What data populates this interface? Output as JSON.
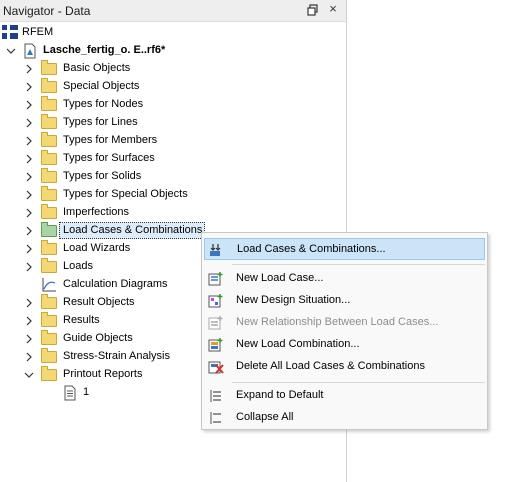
{
  "panel": {
    "title": "Navigator - Data",
    "pin_icon": "pin-icon",
    "close_icon": "close-icon",
    "close_glyph": "×"
  },
  "tree": {
    "root_label": "RFEM",
    "model_label": "Lasche_fertig_o. E..rf6*",
    "items": [
      {
        "label": "Basic Objects",
        "icon": "folder-icon"
      },
      {
        "label": "Special Objects",
        "icon": "folder-icon"
      },
      {
        "label": "Types for Nodes",
        "icon": "folder-icon"
      },
      {
        "label": "Types for Lines",
        "icon": "folder-icon"
      },
      {
        "label": "Types for Members",
        "icon": "folder-icon"
      },
      {
        "label": "Types for Surfaces",
        "icon": "folder-icon"
      },
      {
        "label": "Types for Solids",
        "icon": "folder-icon"
      },
      {
        "label": "Types for Special Objects",
        "icon": "folder-icon"
      },
      {
        "label": "Imperfections",
        "icon": "folder-icon"
      },
      {
        "label": "Load Cases & Combinations",
        "icon": "folder-icon",
        "selected": true
      },
      {
        "label": "Load Wizards",
        "icon": "folder-icon"
      },
      {
        "label": "Loads",
        "icon": "folder-icon"
      },
      {
        "label": "Calculation Diagrams",
        "icon": "diagram-icon"
      },
      {
        "label": "Result Objects",
        "icon": "folder-icon"
      },
      {
        "label": "Results",
        "icon": "folder-icon"
      },
      {
        "label": "Guide Objects",
        "icon": "folder-icon"
      },
      {
        "label": "Stress-Strain Analysis",
        "icon": "folder-icon"
      },
      {
        "label": "Printout Reports",
        "icon": "folder-icon",
        "expanded": true
      }
    ],
    "report_child": "1"
  },
  "context_menu": {
    "items": [
      {
        "label": "Load Cases & Combinations...",
        "icon": "load-cases-icon",
        "highlighted": true
      },
      {
        "label": "New Load Case...",
        "icon": "new-load-case-icon"
      },
      {
        "label": "New Design Situation...",
        "icon": "new-design-situation-icon"
      },
      {
        "label": "New Relationship Between Load Cases...",
        "icon": "new-relationship-icon",
        "disabled": true
      },
      {
        "label": "New Load Combination...",
        "icon": "new-load-combination-icon"
      },
      {
        "label": "Delete All Load Cases & Combinations",
        "icon": "delete-all-icon"
      },
      {
        "label": "Expand to Default",
        "icon": "expand-icon"
      },
      {
        "label": "Collapse All",
        "icon": "collapse-icon"
      }
    ]
  },
  "colors": {
    "highlight": "#cce4f7",
    "folder": "#f5d774",
    "selected_folder": "#a8d5a3",
    "delete_red": "#d32f2f"
  }
}
